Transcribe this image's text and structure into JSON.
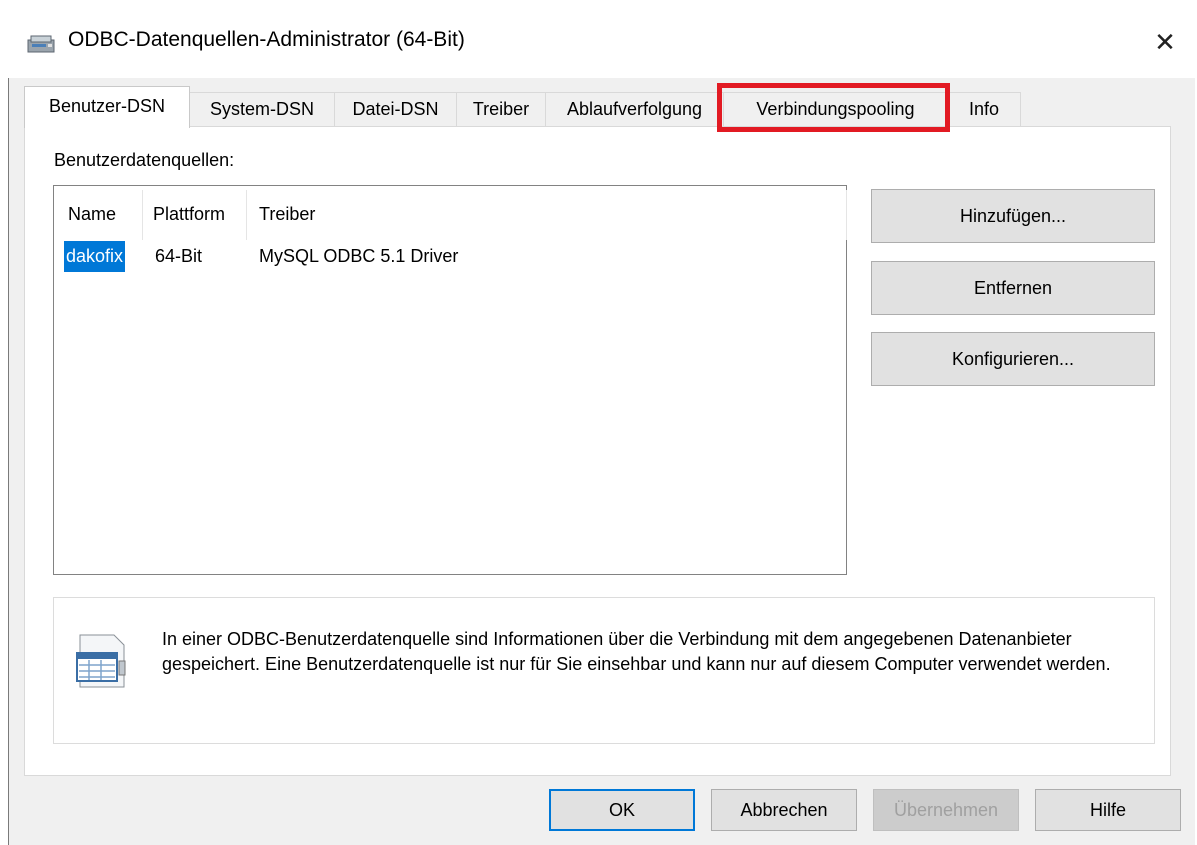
{
  "window": {
    "title": "ODBC-Datenquellen-Administrator (64-Bit)",
    "close_glyph": "✕"
  },
  "tabs": [
    {
      "label": "Benutzer-DSN",
      "active": true
    },
    {
      "label": "System-DSN"
    },
    {
      "label": "Datei-DSN"
    },
    {
      "label": "Treiber"
    },
    {
      "label": "Ablaufverfolgung"
    },
    {
      "label": "Verbindungspooling",
      "highlighted": true
    },
    {
      "label": "Info"
    }
  ],
  "user_dsn": {
    "section_label": "Benutzerdatenquellen:",
    "columns": [
      "Name",
      "Plattform",
      "Treiber"
    ],
    "rows": [
      {
        "name": "dakofix",
        "platform": "64-Bit",
        "driver": "MySQL ODBC 5.1 Driver",
        "selected": true
      }
    ],
    "buttons": {
      "add": "Hinzufügen...",
      "remove": "Entfernen",
      "configure": "Konfigurieren..."
    },
    "info_text": "In einer ODBC-Benutzerdatenquelle sind Informationen über die Verbindung mit dem angegebenen Datenanbieter gespeichert. Eine Benutzerdatenquelle ist nur für Sie einsehbar und kann nur auf diesem Computer verwendet werden."
  },
  "footer": {
    "ok": "OK",
    "cancel": "Abbrechen",
    "apply": "Übernehmen",
    "help": "Hilfe"
  },
  "colors": {
    "highlight": "#e21a23",
    "selection": "#0078d7"
  }
}
